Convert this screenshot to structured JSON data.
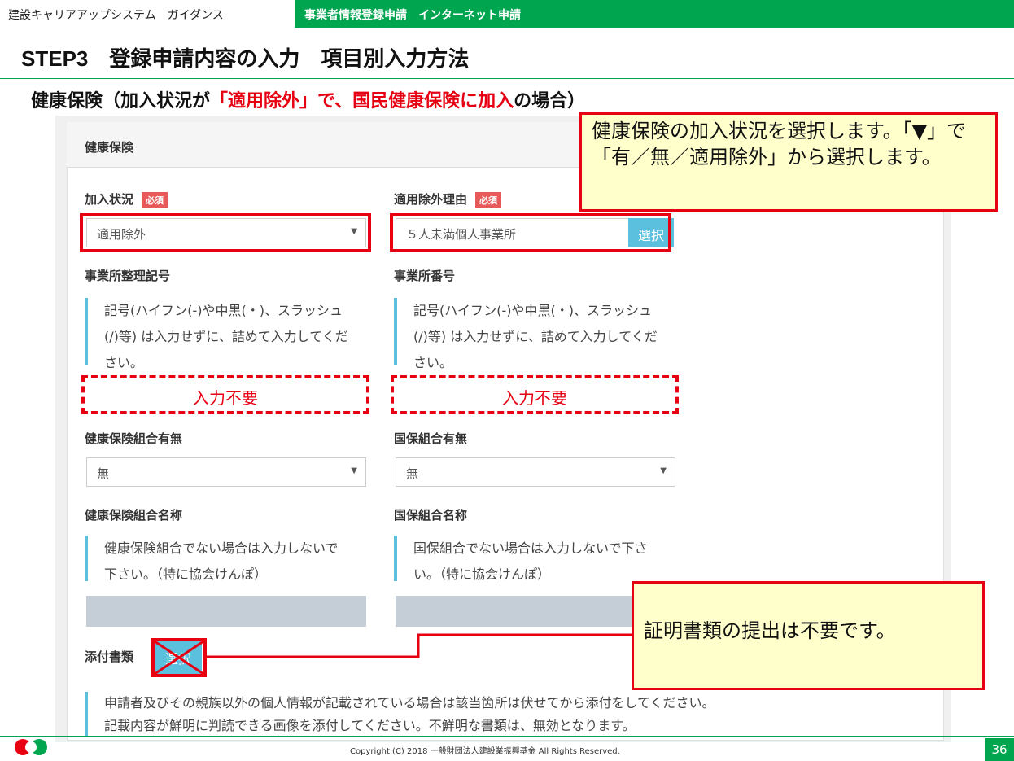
{
  "header": {
    "left_title": "建設キャリアアップシステム　ガイダンス",
    "right_title": "事業者情報登録申請　インターネット申請"
  },
  "page_title": "STEP3　登録申請内容の入力　項目別入力方法",
  "subtitle": {
    "prefix": "健康保険（加入状況が",
    "red1": "「適用除外」で、",
    "red2": "国民健康保険に加入",
    "suffix": "の場合）"
  },
  "form": {
    "section_title": "健康保険",
    "enrollment_status": {
      "label": "加入状況",
      "required": "必須",
      "value": "適用除外"
    },
    "exemption_reason": {
      "label": "適用除外理由",
      "required": "必須",
      "value": "５人未満個人事業所",
      "button": "選択"
    },
    "office_code": {
      "label": "事業所整理記号",
      "note": "記号(ハイフン(-)や中黒(・)、スラッシュ(/)等) は入力せずに、詰めて入力してください。",
      "placeholder_mark": "入力不要"
    },
    "office_number": {
      "label": "事業所番号",
      "note": "記号(ハイフン(-)や中黒(・)、スラッシュ(/)等) は入力せずに、詰めて入力してください。",
      "placeholder_mark": "入力不要"
    },
    "health_union_flag": {
      "label": "健康保険組合有無",
      "value": "無"
    },
    "kokuho_union_flag": {
      "label": "国保組合有無",
      "value": "無"
    },
    "health_union_name": {
      "label": "健康保険組合名称",
      "note": "健康保険組合でない場合は入力しないで下さい。（特に協会けんぽ）"
    },
    "kokuho_union_name": {
      "label": "国保組合名称",
      "note": "国保組合でない場合は入力しないで下さい。（特に協会けんぽ）"
    },
    "attachment": {
      "label": "添付書類",
      "button": "選択",
      "note_line1": "申請者及びその親族以外の個人情報が記載されている場合は該当箇所は伏せてから添付をしてください。",
      "note_line2": "記載内容が鮮明に判読できる画像を添付してください。不鮮明な書類は、無効となります。"
    }
  },
  "callouts": {
    "top": "健康保険の加入状況を選択します。「▼」で「有／無／適用除外」から選択します。",
    "bottom": "証明書類の提出は不要です。"
  },
  "footer": {
    "copyright": "Copyright (C) 2018 一般財団法人建設業振興基金 All Rights Reserved.",
    "page_number": "36"
  },
  "colors": {
    "brand_green": "#00a550",
    "accent_red": "#e60012",
    "info_blue": "#5bc0de",
    "callout_yellow": "#ffffcc"
  }
}
